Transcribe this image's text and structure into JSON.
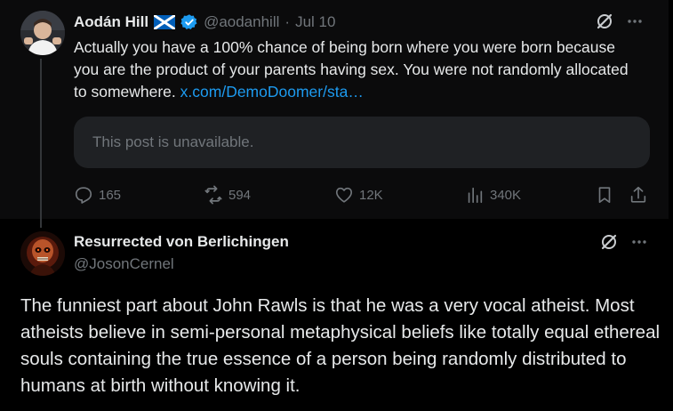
{
  "post1": {
    "author_name": "Aodán Hill",
    "flag_icon": "scotland-flag-icon",
    "handle": "@aodanhill",
    "separator": "·",
    "date": "Jul 10",
    "text": "Actually you have a 100% chance of being born where you were born because you are the product of your parents having sex. You were not randomly allocated to somewhere.",
    "link_text": "x.com/DemoDoomer/sta…",
    "quote_unavailable": "This post is unavailable.",
    "actions": {
      "replies": "165",
      "reposts": "594",
      "likes": "12K",
      "views": "340K"
    }
  },
  "post2": {
    "author_name": "Resurrected von Berlichingen",
    "handle": "@JosonCernel",
    "text": "The funniest part about John Rawls is that he was a very vocal atheist. Most atheists believe in semi-personal metaphysical beliefs like totally equal ethereal souls containing the true essence of a person being randomly distributed to humans at birth without knowing it."
  },
  "colors": {
    "background": "#000000",
    "text": "#e7e9ea",
    "muted": "#71767b",
    "link": "#1d9bf0",
    "verified": "#1d9bf0"
  }
}
